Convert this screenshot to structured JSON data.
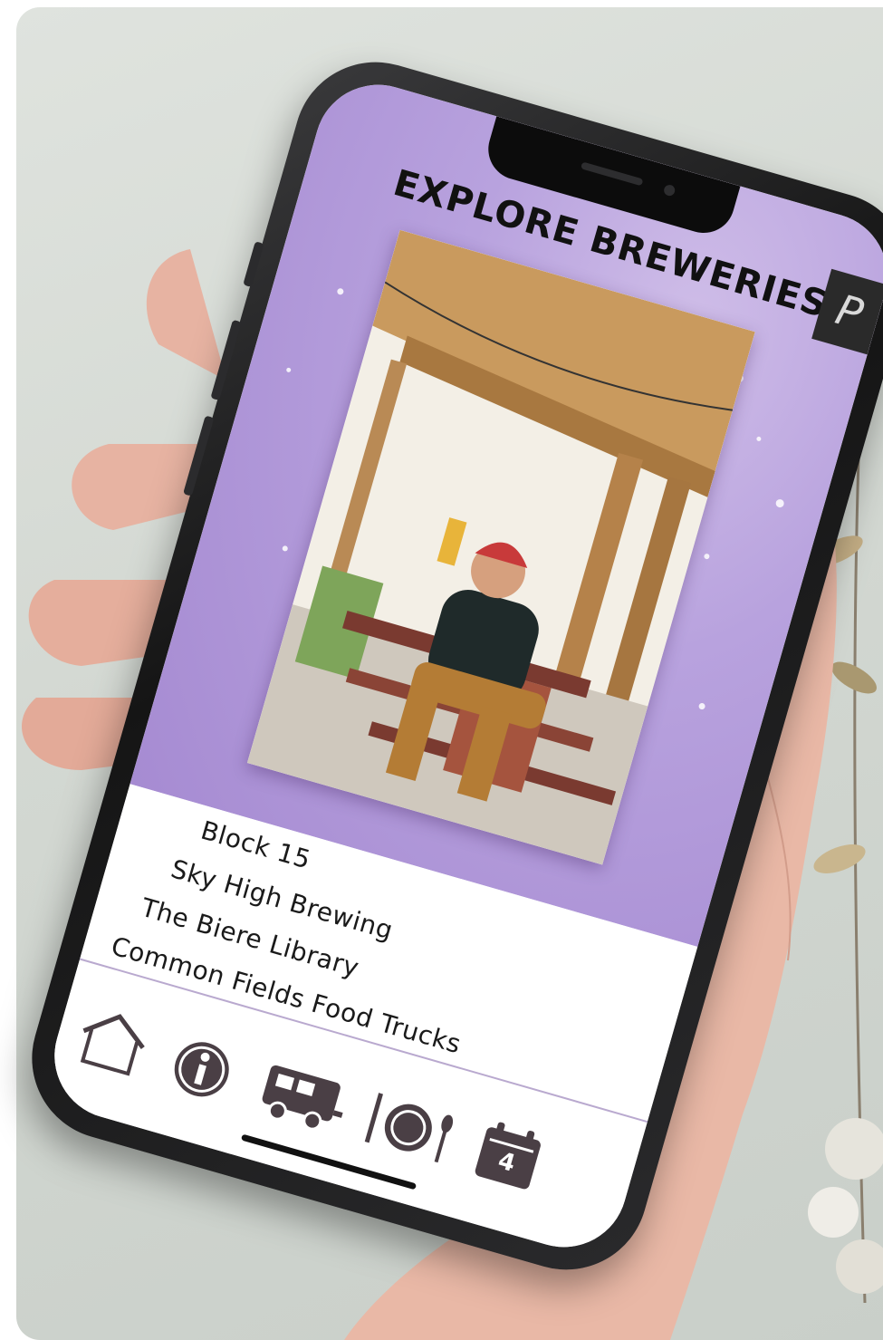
{
  "app": {
    "title": "EXPLORE BREWERIES",
    "badge_letter": "P"
  },
  "breweries": [
    {
      "name": "Block 15"
    },
    {
      "name": "Sky High Brewing"
    },
    {
      "name": "The Biere Library"
    },
    {
      "name": "Common Fields Food Trucks"
    }
  ],
  "calendar_icon": {
    "day": "4"
  },
  "nav_icons": [
    "home-icon",
    "info-icon",
    "food-truck-icon",
    "dining-icon",
    "calendar-icon"
  ],
  "colors": {
    "hero_purple": "#b8a2de",
    "icon_dark": "#4a3f45",
    "divider": "#b9a9cf",
    "backdrop": "#d3d8d2"
  }
}
